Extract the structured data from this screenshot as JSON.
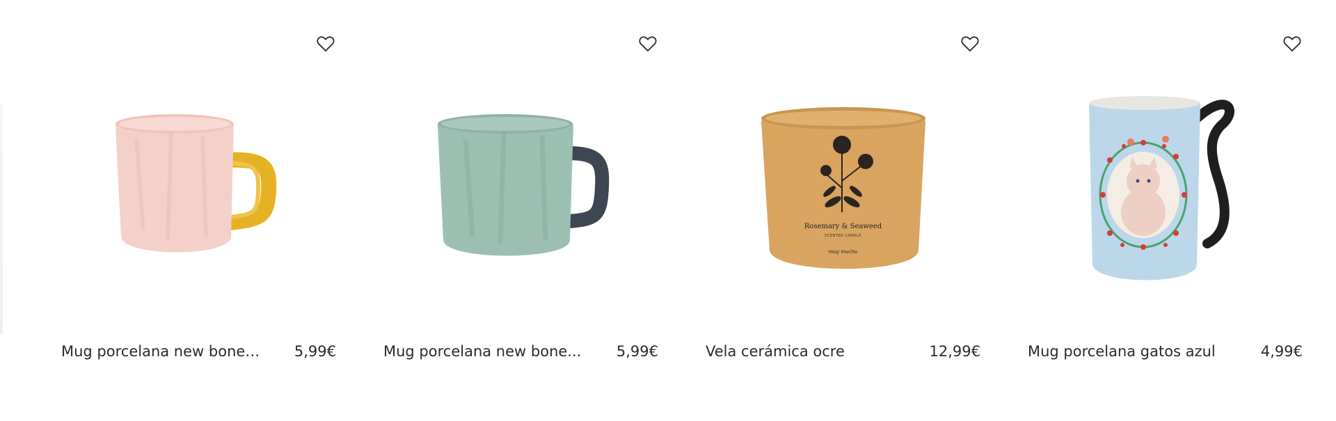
{
  "products": [
    {
      "name": "Mug porcelana new bone rosa",
      "price": "5,99€",
      "image_icon": "pink-mug-yellow-handle"
    },
    {
      "name": "Mug porcelana new bone...",
      "price": "5,99€",
      "image_icon": "green-mug-dark-handle"
    },
    {
      "name": "Vela cerámica ocre",
      "price": "12,99€",
      "image_icon": "ochre-ceramic-candle",
      "label_line1": "Rosemary & Seaweed",
      "label_line2": "SCENTED CANDLE",
      "brand": "muy mucho"
    },
    {
      "name": "Mug porcelana gatos azul",
      "price": "4,99€",
      "image_icon": "blue-cat-mug"
    }
  ],
  "colors": {
    "pink_mug": "#f3d1c9",
    "yellow_handle": "#e6b225",
    "green_mug": "#9dbfb2",
    "dark_handle": "#3d4652",
    "ochre": "#d8a460",
    "blue_mug": "#bcd7ea",
    "black_handle": "#1f1f1f"
  }
}
